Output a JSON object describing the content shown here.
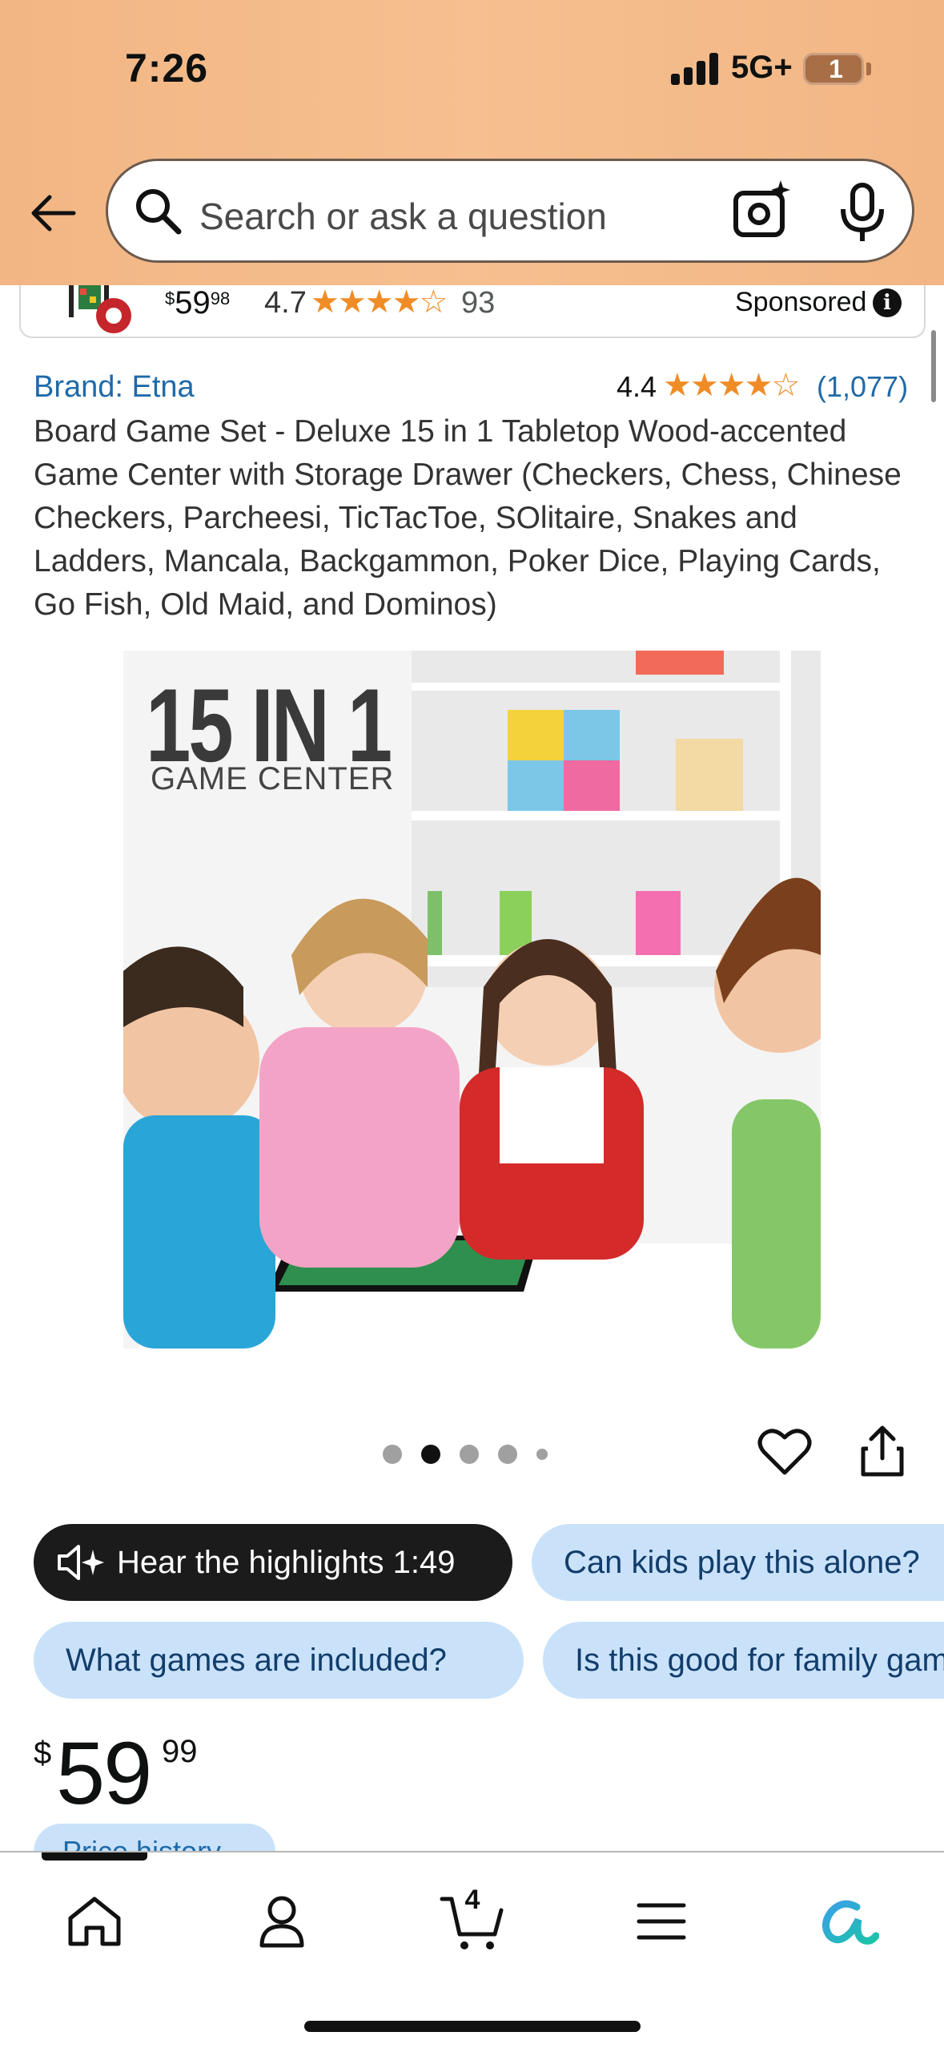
{
  "status_bar": {
    "time": "7:26",
    "network": "5G+",
    "battery": "1"
  },
  "search": {
    "placeholder": "Search or ask a question"
  },
  "sponsored": {
    "price_whole": "59",
    "price_fraction": "98",
    "price_symbol": "$",
    "rating": "4.7",
    "stars": "★★★★☆",
    "review_count": "93",
    "label": "Sponsored"
  },
  "product": {
    "brand": "Brand: Etna",
    "rating": "4.4",
    "stars": "★★★★☆",
    "rating_count": "(1,077)",
    "title": "Board Game Set - Deluxe 15 in 1 Tabletop Wood-accented Game Center with Storage Drawer (Checkers, Chess, Chinese Checkers, Parcheesi, TicTacToe, SOlitaire, Snakes and Ladders, Mancala, Backgammon, Poker Dice, Playing Cards, Go Fish, Old Maid, and Dominos)",
    "image_text_big": "15 IN 1",
    "image_text_small": "GAME CENTER"
  },
  "carousel": {
    "total_dots": 5,
    "active_index": 1
  },
  "chips": {
    "highlights": "Hear the highlights 1:49",
    "q1": "Can kids play this alone?",
    "q2": "What games are included?",
    "q3": "Is this good for family game night?"
  },
  "price": {
    "symbol": "$",
    "whole": "59",
    "fraction": "99",
    "history_label": "Price history"
  },
  "nav": {
    "cart_count": "4",
    "items": [
      "home-icon",
      "account-icon",
      "cart-icon",
      "menu-icon",
      "rufus-icon"
    ]
  },
  "colors": {
    "header_bg": "#f5b98a",
    "link_blue": "#1f6aa8",
    "star_orange": "#f08c26",
    "chip_blue": "#c9e2fa",
    "chip_dark": "#1b1b1b"
  }
}
